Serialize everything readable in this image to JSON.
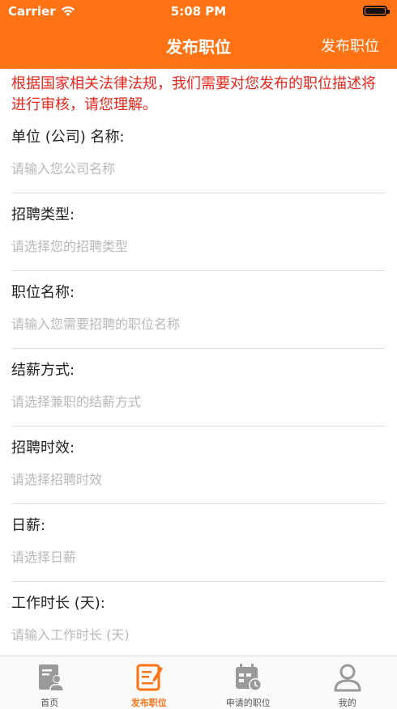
{
  "status_bar": {
    "carrier": "Carrier",
    "time": "5:08 PM"
  },
  "navbar": {
    "title": "发布职位",
    "action": "发布职位"
  },
  "notice": "根据国家相关法律法规，我们需要对您发布的职位描述将进行审核，请您理解。",
  "fields": [
    {
      "label": "单位 (公司) 名称:",
      "placeholder": "请输入您公司名称",
      "value": ""
    },
    {
      "label": "招聘类型:",
      "placeholder": "请选择您的招聘类型",
      "value": ""
    },
    {
      "label": "职位名称:",
      "placeholder": "请输入您需要招聘的职位名称",
      "value": ""
    },
    {
      "label": "结薪方式:",
      "placeholder": "请选择兼职的结薪方式",
      "value": ""
    },
    {
      "label": "招聘时效:",
      "placeholder": "请选择招聘时效",
      "value": ""
    },
    {
      "label": "日薪:",
      "placeholder": "请选择日薪",
      "value": ""
    },
    {
      "label": "工作时长 (天):",
      "placeholder": "请输入工作时长 (天)",
      "value": ""
    }
  ],
  "tabs": [
    {
      "label": "首页",
      "icon": "home-profile-icon",
      "active": false
    },
    {
      "label": "发布职位",
      "icon": "edit-document-icon",
      "active": true
    },
    {
      "label": "申请的职位",
      "icon": "calendar-clock-icon",
      "active": false
    },
    {
      "label": "我的",
      "icon": "user-icon",
      "active": false
    }
  ],
  "colors": {
    "accent": "#ff7315",
    "notice": "#e8261c",
    "tab_inactive": "#555555",
    "placeholder": "#b9b9b9"
  }
}
